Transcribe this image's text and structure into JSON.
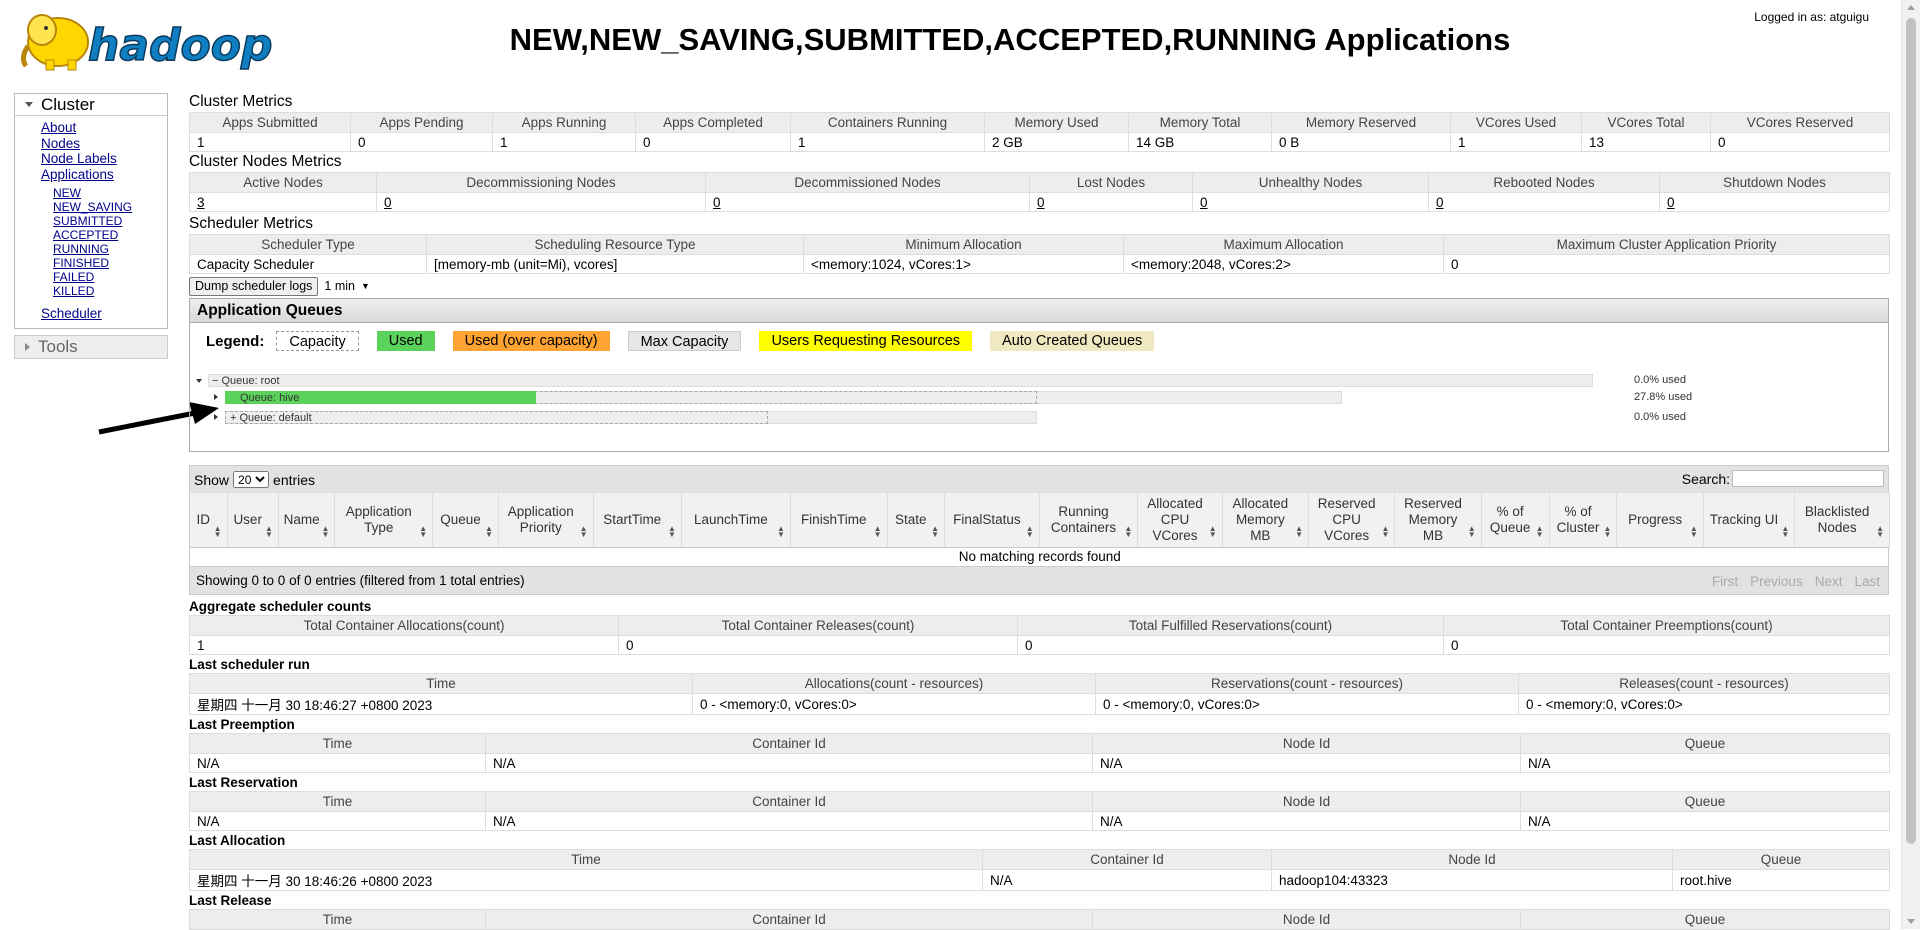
{
  "header": {
    "title": "NEW,NEW_SAVING,SUBMITTED,ACCEPTED,RUNNING Applications",
    "logged_in": "Logged in as: atguigu",
    "logo_text": "hadoop"
  },
  "sidebar": {
    "cluster_label": "Cluster",
    "links": [
      "About",
      "Nodes",
      "Node Labels",
      "Applications"
    ],
    "app_states": [
      "NEW",
      "NEW_SAVING",
      "SUBMITTED",
      "ACCEPTED",
      "RUNNING",
      "FINISHED",
      "FAILED",
      "KILLED"
    ],
    "scheduler_label": "Scheduler",
    "tools_label": "Tools"
  },
  "cluster_metrics": {
    "title": "Cluster Metrics",
    "headers": [
      "Apps Submitted",
      "Apps Pending",
      "Apps Running",
      "Apps Completed",
      "Containers Running",
      "Memory Used",
      "Memory Total",
      "Memory Reserved",
      "VCores Used",
      "VCores Total",
      "VCores Reserved"
    ],
    "values": [
      "1",
      "0",
      "1",
      "0",
      "1",
      "2 GB",
      "14 GB",
      "0 B",
      "1",
      "13",
      "0"
    ]
  },
  "node_metrics": {
    "title": "Cluster Nodes Metrics",
    "headers": [
      "Active Nodes",
      "Decommissioning Nodes",
      "Decommissioned Nodes",
      "Lost Nodes",
      "Unhealthy Nodes",
      "Rebooted Nodes",
      "Shutdown Nodes"
    ],
    "values": [
      "3",
      "0",
      "0",
      "0",
      "0",
      "0",
      "0"
    ]
  },
  "scheduler_metrics": {
    "title": "Scheduler Metrics",
    "headers": [
      "Scheduler Type",
      "Scheduling Resource Type",
      "Minimum Allocation",
      "Maximum Allocation",
      "Maximum Cluster Application Priority"
    ],
    "values": [
      "Capacity Scheduler",
      "[memory-mb (unit=Mi), vcores]",
      "<memory:1024, vCores:1>",
      "<memory:2048, vCores:2>",
      "0"
    ]
  },
  "dump": {
    "button": "Dump scheduler logs",
    "interval": "1 min"
  },
  "queues": {
    "title": "Application Queues",
    "legend_label": "Legend:",
    "legend": [
      {
        "label": "Capacity",
        "color": "#ffffff"
      },
      {
        "label": "Used",
        "color": "#5bd35b"
      },
      {
        "label": "Used (over capacity)",
        "color": "#ffa333"
      },
      {
        "label": "Max Capacity",
        "color": "#e6e6e6"
      },
      {
        "label": "Users Requesting Resources",
        "color": "#ffff00"
      },
      {
        "label": "Auto Created Queues",
        "color": "#f0e8c0"
      }
    ],
    "items": [
      {
        "name": "Queue: root",
        "prefix": "−",
        "used": "0.0% used",
        "used_fraction": 0.0
      },
      {
        "name": "Queue: hive",
        "prefix": "",
        "used": "27.8% used",
        "used_fraction": 0.278
      },
      {
        "name": "Queue: default",
        "prefix": "+",
        "used": "0.0% used",
        "used_fraction": 0.0
      }
    ]
  },
  "apps_table": {
    "show_label": "Show",
    "entries_value": "20",
    "entries_label": "entries",
    "search_label": "Search:",
    "headers": [
      "ID",
      "User",
      "Name",
      "Application Type",
      "Queue",
      "Application Priority",
      "StartTime",
      "LaunchTime",
      "FinishTime",
      "State",
      "FinalStatus",
      "Running Containers",
      "Allocated CPU VCores",
      "Allocated Memory MB",
      "Reserved CPU VCores",
      "Reserved Memory MB",
      "% of Queue",
      "% of Cluster",
      "Progress",
      "Tracking UI",
      "Blacklisted Nodes"
    ],
    "empty_message": "No matching records found",
    "showing": "Showing 0 to 0 of 0 entries (filtered from 1 total entries)",
    "pager": [
      "First",
      "Previous",
      "Next",
      "Last"
    ]
  },
  "aggregate": {
    "title": "Aggregate scheduler counts",
    "headers": [
      "Total Container Allocations(count)",
      "Total Container Releases(count)",
      "Total Fulfilled Reservations(count)",
      "Total Container Preemptions(count)"
    ],
    "values": [
      "1",
      "0",
      "0",
      "0"
    ]
  },
  "last_run": {
    "title": "Last scheduler run",
    "headers": [
      "Time",
      "Allocations(count - resources)",
      "Reservations(count - resources)",
      "Releases(count - resources)"
    ],
    "values": [
      "星期四 十一月 30 18:46:27 +0800 2023",
      "0 - <memory:0, vCores:0>",
      "0 - <memory:0, vCores:0>",
      "0 - <memory:0, vCores:0>"
    ]
  },
  "last_preemption": {
    "title": "Last Preemption",
    "headers": [
      "Time",
      "Container Id",
      "Node Id",
      "Queue"
    ],
    "values": [
      "N/A",
      "N/A",
      "N/A",
      "N/A"
    ]
  },
  "last_reservation": {
    "title": "Last Reservation",
    "headers": [
      "Time",
      "Container Id",
      "Node Id",
      "Queue"
    ],
    "values": [
      "N/A",
      "N/A",
      "N/A",
      "N/A"
    ]
  },
  "last_allocation": {
    "title": "Last Allocation",
    "headers": [
      "Time",
      "Container Id",
      "Node Id",
      "Queue"
    ],
    "values": [
      "星期四 十一月 30 18:46:26 +0800 2023",
      "N/A",
      "hadoop104:43323",
      "root.hive"
    ]
  },
  "last_release": {
    "title": "Last Release",
    "headers": [
      "Time",
      "Container Id",
      "Node Id",
      "Queue"
    ]
  }
}
